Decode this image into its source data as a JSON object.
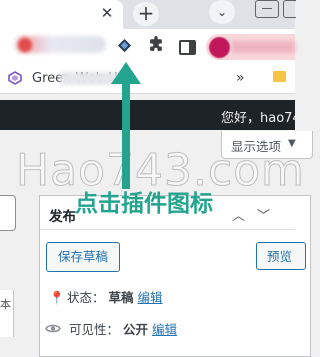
{
  "browser": {
    "tab_close_icon": "close-icon",
    "new_tab_glyph": "+",
    "tab_search_glyph": "⌄",
    "toolbar": {
      "extension_icon": "wordpress-plugin-icon",
      "extensions_icon": "puzzle-icon",
      "side_panel_icon": "side-panel-icon"
    },
    "bookmarks": {
      "first_label": "Green Web H",
      "more_glyph": "»"
    }
  },
  "admin_bar": {
    "greeting": "您好，hao74"
  },
  "screen_options": {
    "label": "显示选项",
    "arrow": "▼"
  },
  "left_column": {
    "char": "本"
  },
  "publish_box": {
    "title": "发布",
    "save_draft": "保存草稿",
    "preview": "预览",
    "status_label": "状态：",
    "status_value": "草稿",
    "status_edit": "编辑",
    "visibility_label": "可见性：",
    "visibility_value": "公开",
    "visibility_edit": "编辑"
  },
  "overlay": {
    "watermark": "Hao743.com",
    "annotation": "点击插件图标",
    "accent_color": "#23a48e"
  }
}
